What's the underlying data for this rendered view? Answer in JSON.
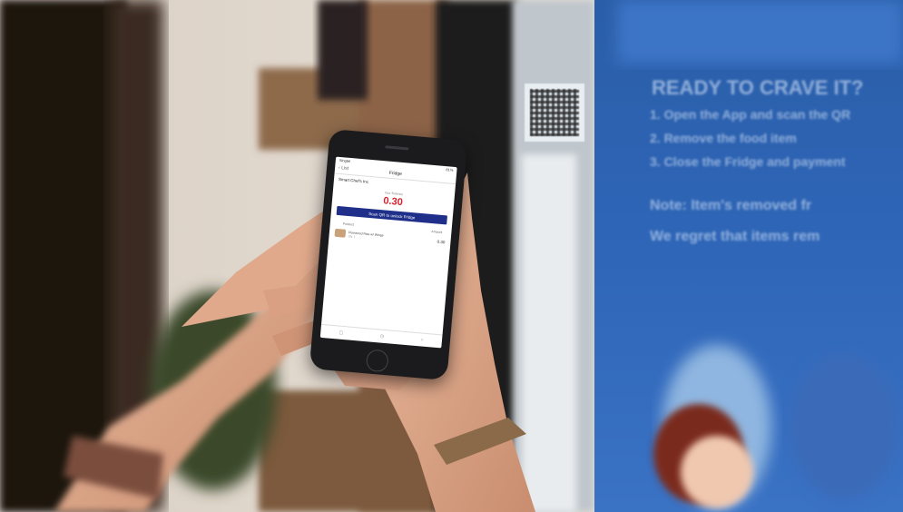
{
  "phone_app": {
    "status_left": "Singtel",
    "status_right": "81%",
    "back_label": "List",
    "title": "Fridge",
    "shop_name": "Smart Chef's Inc",
    "total_label": "Your Balance",
    "total_amount": "0.30",
    "scan_button": "Scan QR to unlock Fridge",
    "col_product": "Product",
    "col_amount": "Amount",
    "item_name": "Flavoured Rice w/ Wings",
    "item_qty": "Qty: 1",
    "item_amount": "0.30"
  },
  "kiosk_sign": {
    "heading": "READY TO CRAVE IT?",
    "step_1": "1. Open the App and scan the QR",
    "step_2": "2. Remove the food item",
    "step_3": "3. Close the Fridge and payment",
    "note_1": "Note: Item's removed fr",
    "note_2": "We regret that items rem"
  },
  "colors": {
    "accent_red": "#d8202c",
    "button_blue": "#1f2f8a",
    "sign_blue": "#2d5fb0"
  }
}
